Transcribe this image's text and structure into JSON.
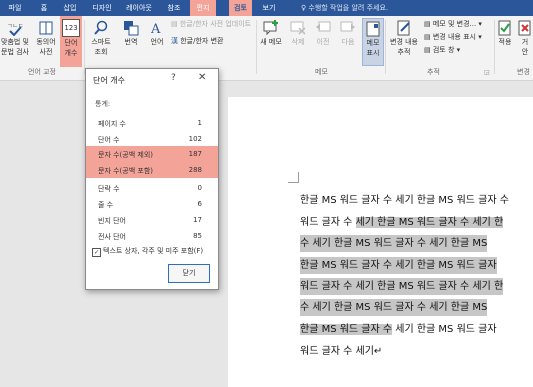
{
  "tabs": [
    {
      "label": "파일"
    },
    {
      "label": "홈"
    },
    {
      "label": "삽입"
    },
    {
      "label": "디자인"
    },
    {
      "label": "레이아웃"
    },
    {
      "label": "참조"
    },
    {
      "label": "편지"
    },
    {
      "label": "검토"
    },
    {
      "label": "보기"
    }
  ],
  "tell_me": "수행할 작업을 알려 주세요.",
  "ribbon": {
    "spellcheck": "맞춤법 및\n문법 검사",
    "thesaurus": "동의어\n사전",
    "word_count": "단어\n개수",
    "word_count_badge": "123",
    "smart_lookup": "스마트\n조회",
    "translate": "번역",
    "language": "언어",
    "proofing_group": "언어 교정",
    "hanja_update": "한글/한자 사전 업데이트",
    "hanja_convert": "한글/한자 변환",
    "new_comment": "새 메모",
    "delete": "삭제",
    "previous": "이전",
    "next": "다음",
    "show_comments": "메모\n표시",
    "comments_group": "메모",
    "track_changes": "변경 내용\n추적",
    "markup": "메모 및 변경...",
    "show_markup": "변경 내용 표시",
    "reviewing_pane": "검토 창",
    "tracking_group": "추적",
    "accept": "적용",
    "reject": "거\n안",
    "changes_group": "변경"
  },
  "dialog": {
    "title": "단어 개수",
    "help": "?",
    "close_x": "✕",
    "section": "통계:",
    "rows": [
      {
        "label": "페이지 수",
        "value": "1"
      },
      {
        "label": "단어 수",
        "value": "102"
      },
      {
        "label": "문자 수(공백 제외)",
        "value": "187"
      },
      {
        "label": "문자 수(공백 포함)",
        "value": "288"
      },
      {
        "label": "단락 수",
        "value": "0"
      },
      {
        "label": "줄 수",
        "value": "6"
      },
      {
        "label": "빈지 단어",
        "value": "17"
      },
      {
        "label": "전사 단어",
        "value": "85"
      }
    ],
    "checkbox_label": "텍스트 상자, 각주 및 미주 포함(F)",
    "checkbox_mark": "✓",
    "close_button": "닫기"
  },
  "document": {
    "lines": [
      {
        "plain": "한글 MS 워드 글자 수 세기 한글 MS 워드 글자 수",
        "sel": ""
      },
      {
        "plain": "워드 글자 수 ",
        "sel": "세기 한글 MS 워드 글자 수 세기 한"
      },
      {
        "plain": "",
        "sel": "수 세기 한글 MS 워드 글자 수 세기 한글 MS"
      },
      {
        "plain": "",
        "sel": "한글 MS 워드 글자 수 세기 한글 MS 워드 글자"
      },
      {
        "plain": "",
        "sel": "워드 글자 수 세기 한글 MS 워드 글자 수 세기 한"
      },
      {
        "plain": "",
        "sel": "수 세기 한글 MS 워드 글자 수 세기 한글 MS"
      },
      {
        "plain": "",
        "sel": "한글 MS 워드 글자 수",
        "after": " 세기 한글 MS 워드 글자"
      },
      {
        "plain": "워드 글자 수 세기↵",
        "sel": ""
      }
    ]
  },
  "colors": {
    "ribbon_blue": "#2b579a",
    "highlight": "#f4a399",
    "selection": "#c6c6c6"
  }
}
